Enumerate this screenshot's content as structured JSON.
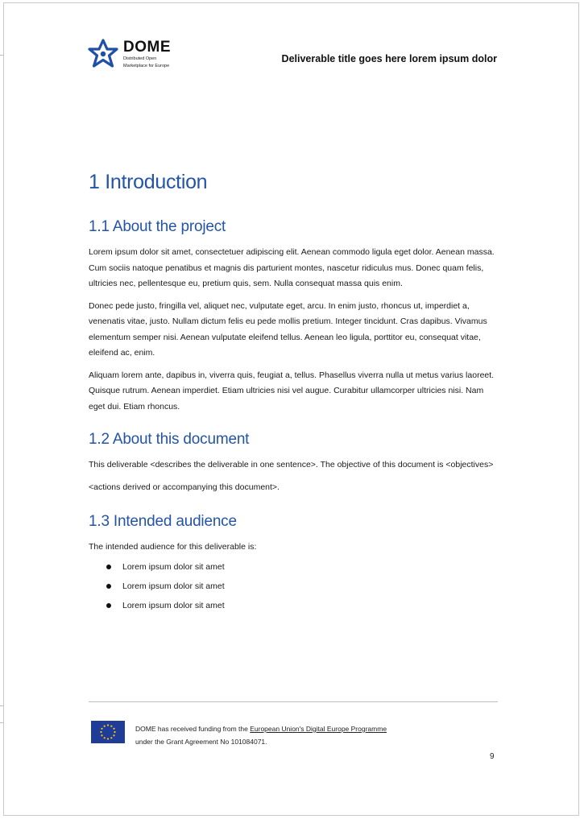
{
  "header": {
    "logo_name": "DOME",
    "logo_subtitle_line1": "Distributed Open",
    "logo_subtitle_line2": "Marketplace for Europe",
    "deliverable_title": "Deliverable title goes here lorem ipsum dolor",
    "logo_color": "#1f4fa8"
  },
  "chapter_title": "1 Introduction",
  "sections": {
    "about_project": {
      "title": "1.1 About the project",
      "paragraphs": [
        "Lorem ipsum dolor sit amet, consectetuer adipiscing elit. Aenean commodo ligula eget dolor. Aenean massa. Cum sociis natoque penatibus et magnis dis parturient montes, nascetur ridiculus mus. Donec quam felis, ultricies nec, pellentesque eu, pretium quis, sem. Nulla consequat massa quis enim.",
        "Donec pede justo, fringilla vel, aliquet nec, vulputate eget, arcu. In enim justo, rhoncus ut, imperdiet a, venenatis vitae, justo. Nullam dictum felis eu pede mollis pretium. Integer tincidunt. Cras dapibus. Vivamus elementum semper nisi. Aenean vulputate eleifend tellus. Aenean leo ligula, porttitor eu, consequat vitae, eleifend ac, enim.",
        "Aliquam lorem ante, dapibus in, viverra quis, feugiat a, tellus. Phasellus viverra nulla ut metus varius laoreet. Quisque rutrum. Aenean imperdiet. Etiam ultricies nisi vel augue. Curabitur ullamcorper ultricies nisi. Nam eget dui. Etiam rhoncus."
      ]
    },
    "about_document": {
      "title": "1.2 About this document",
      "paragraphs": [
        "This deliverable <describes the deliverable in one sentence>. The objective of this document is <objectives>",
        "<actions derived or accompanying this document>."
      ]
    },
    "intended_audience": {
      "title": "1.3 Intended audience",
      "intro": "The intended audience for this deliverable is:",
      "items": [
        "Lorem ipsum dolor sit amet",
        "Lorem ipsum dolor sit amet",
        "Lorem ipsum dolor sit amet"
      ]
    }
  },
  "footer": {
    "funding_prefix": "DOME has received funding from the ",
    "funding_link": "European Union's Digital Europe Programme",
    "grant_line": "under the Grant Agreement No 101084071.",
    "page_number": "9",
    "flag_color": "#1f3c99",
    "star_color": "#ffcc00"
  },
  "colors": {
    "heading": "#2354a8",
    "body_text": "#1a1a1a"
  }
}
